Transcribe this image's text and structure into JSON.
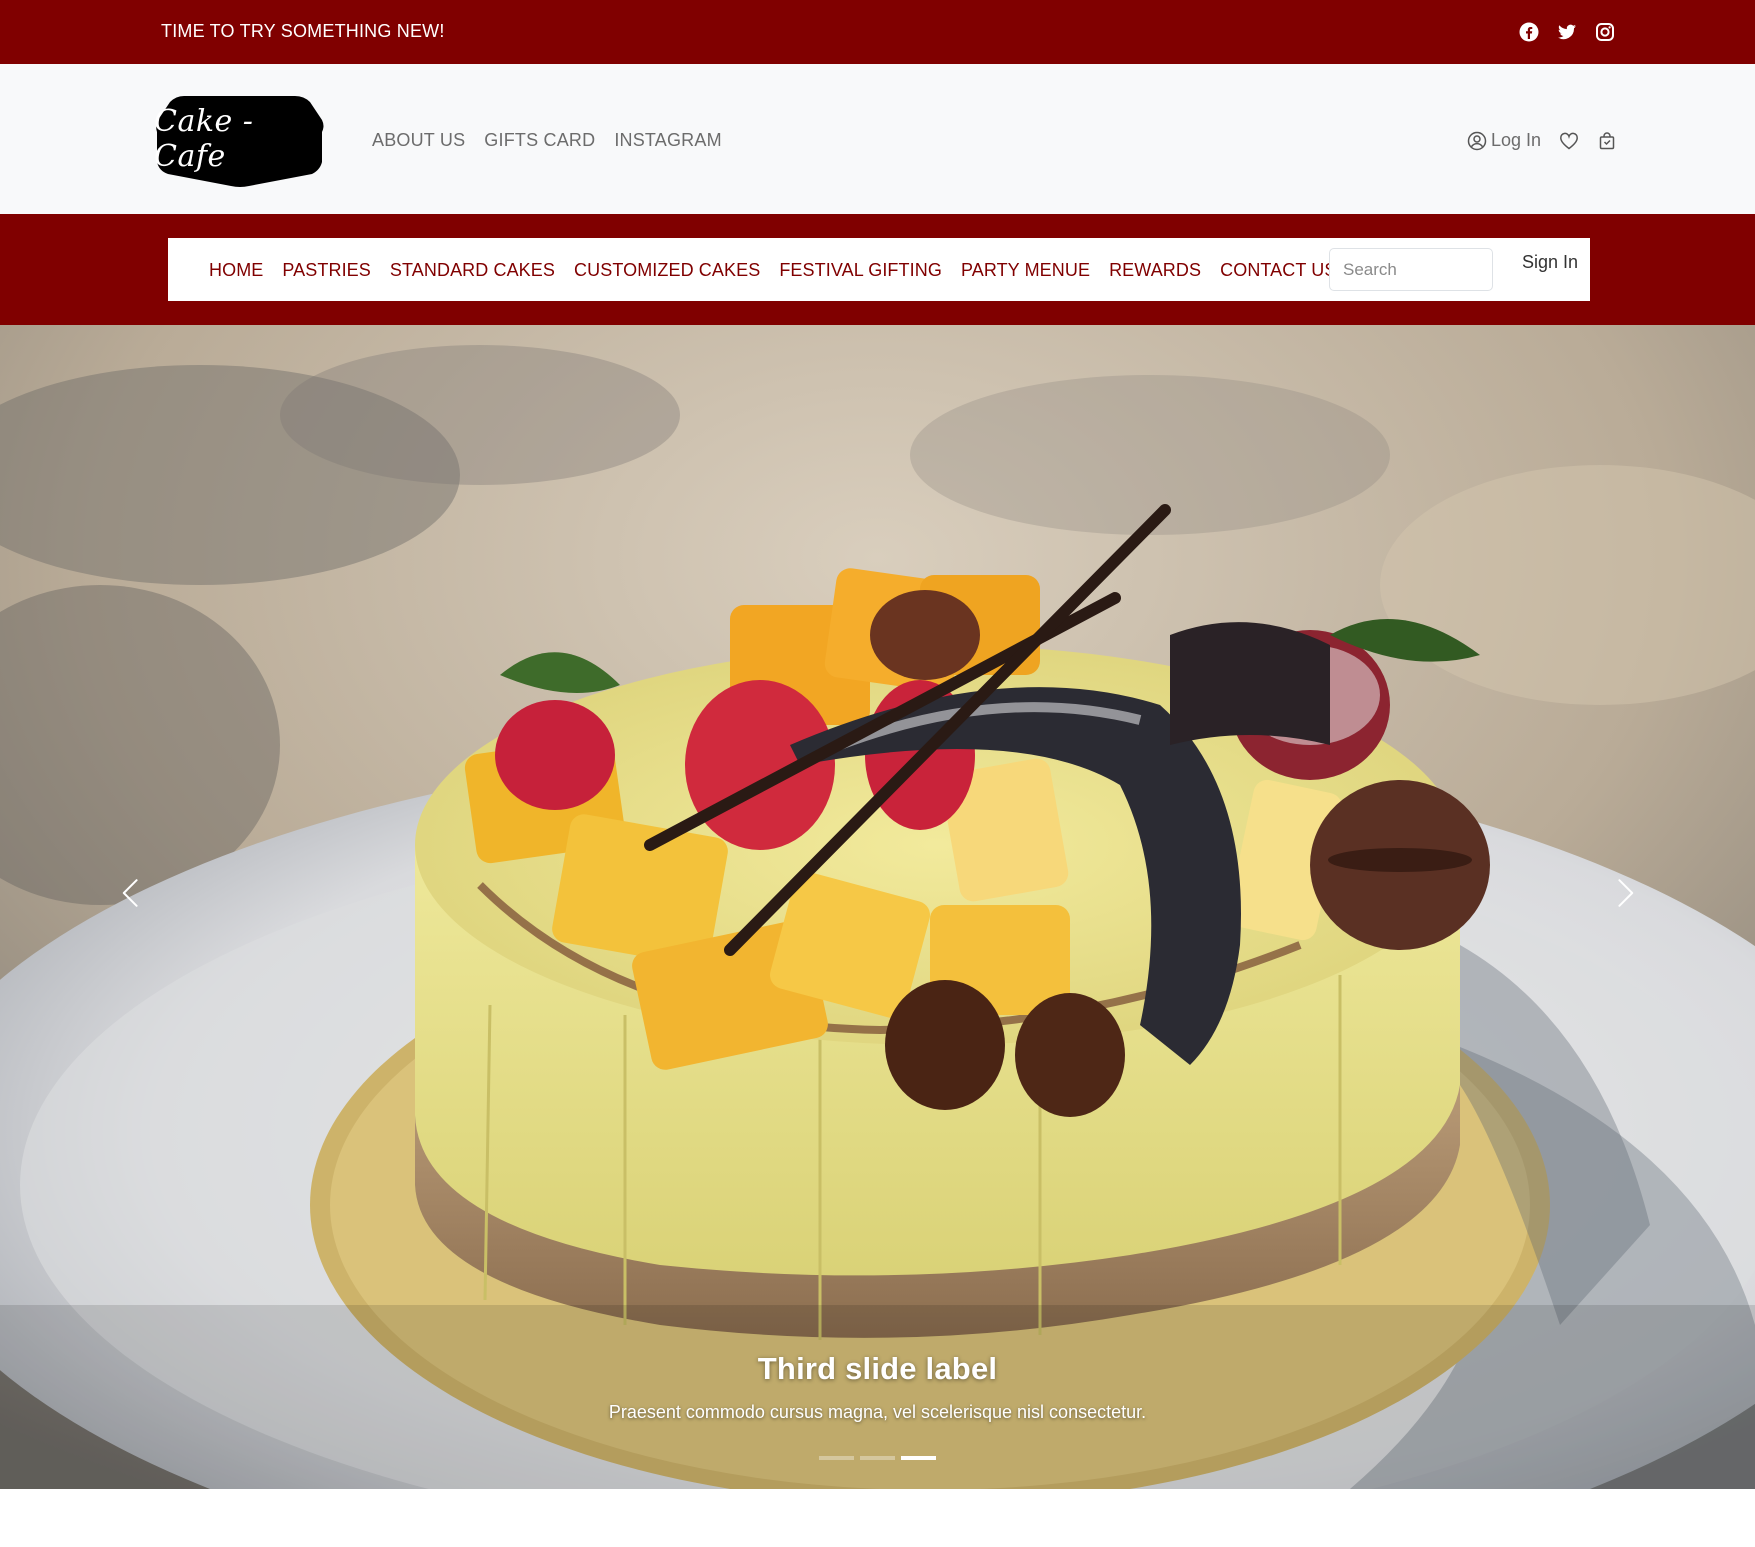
{
  "topbar": {
    "announcement": "TIME TO TRY SOMETHING NEW!",
    "background_color": "#800000",
    "socials": [
      {
        "icon": "facebook-icon"
      },
      {
        "icon": "twitter-icon"
      },
      {
        "icon": "instagram-icon"
      }
    ]
  },
  "header": {
    "logo_text": "Cake - Cafe",
    "links": [
      "ABOUT US",
      "GIFTS CARD",
      "INSTAGRAM"
    ],
    "login_label": "Log In",
    "icons": [
      "user-circle-icon",
      "heart-icon",
      "shopping-bag-icon"
    ]
  },
  "nav": {
    "items": [
      "HOME",
      "PASTRIES",
      "STANDARD CAKES",
      "CUSTOMIZED CAKES",
      "FESTIVAL GIFTING",
      "PARTY MENUE",
      "REWARDS",
      "CONTACT US"
    ],
    "search_placeholder": "Search",
    "signin_label": "Sign In",
    "accent_color": "#800000"
  },
  "carousel": {
    "caption_title": "Third slide label",
    "caption_text": "Praesent commodo cursus magna, vel scelerisque nisl consectetur.",
    "indicators": [
      false,
      false,
      true
    ],
    "controls": [
      "chevron-left-icon",
      "chevron-right-icon"
    ]
  }
}
